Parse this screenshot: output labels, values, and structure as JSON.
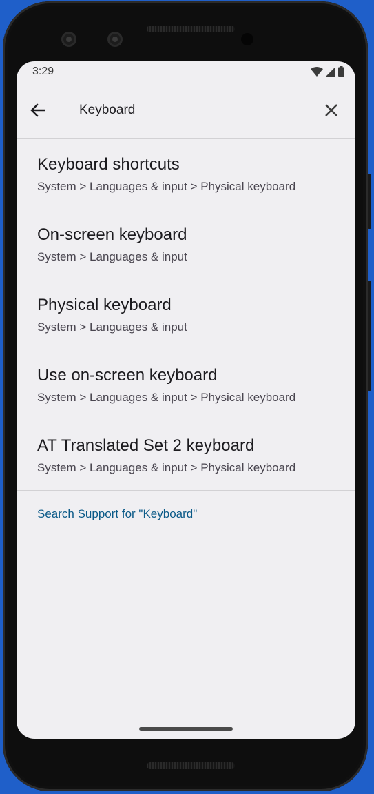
{
  "status_bar": {
    "time": "3:29",
    "icons": [
      "wifi-icon",
      "signal-icon",
      "battery-icon"
    ]
  },
  "toolbar": {
    "back_icon": "arrow-back-icon",
    "search_value": "Keyboard",
    "clear_icon": "close-icon"
  },
  "results": [
    {
      "title": "Keyboard shortcuts",
      "path": "System > Languages & input > Physical keyboard"
    },
    {
      "title": "On-screen keyboard",
      "path": "System > Languages & input"
    },
    {
      "title": "Physical keyboard",
      "path": "System > Languages & input"
    },
    {
      "title": "Use on-screen keyboard",
      "path": "System > Languages & input > Physical keyboard"
    },
    {
      "title": "AT Translated Set 2 keyboard",
      "path": "System > Languages & input > Physical keyboard"
    }
  ],
  "support_link": "Search Support for \"Keyboard\"",
  "colors": {
    "screen_background": "#f0eff2",
    "link": "#0b5a88",
    "desktop_background": "#1f5fc9"
  }
}
